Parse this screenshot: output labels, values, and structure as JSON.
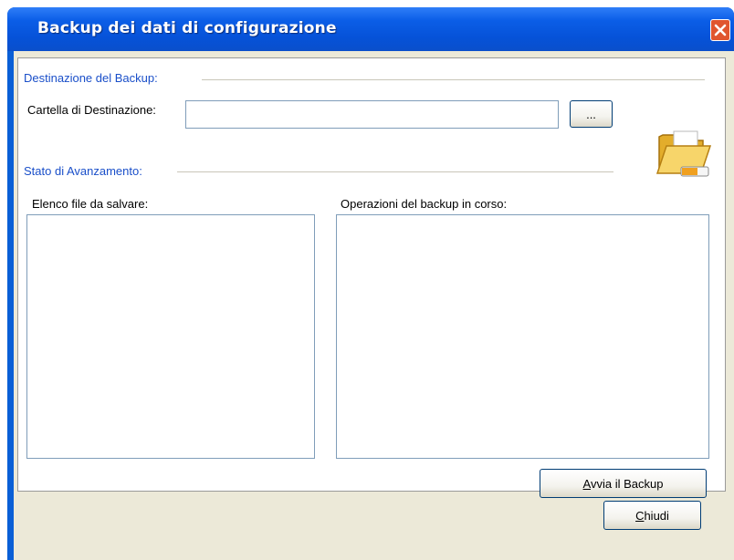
{
  "window": {
    "title": "Backup dei dati di configurazione",
    "close_icon": "close-icon"
  },
  "destination": {
    "section_label": "Destinazione del Backup:",
    "folder_label": "Cartella di Destinazione:",
    "folder_value": "",
    "browse_label": "..."
  },
  "progress": {
    "section_label": "Stato di Avanzamento:",
    "files_label": "Elenco file da salvare:",
    "files": [],
    "operations_label": "Operazioni del backup in corso:",
    "operations": []
  },
  "buttons": {
    "start_prefix": "A",
    "start_rest": "vvia il Backup",
    "close_prefix": "C",
    "close_rest": "hiudi"
  },
  "icons": {
    "folder": "folder-icon"
  },
  "colors": {
    "title_bar": "#0b5ee7",
    "section_text": "#1a4fc9",
    "dialog_bg": "#ece9d8",
    "close_button": "#e0552f"
  }
}
